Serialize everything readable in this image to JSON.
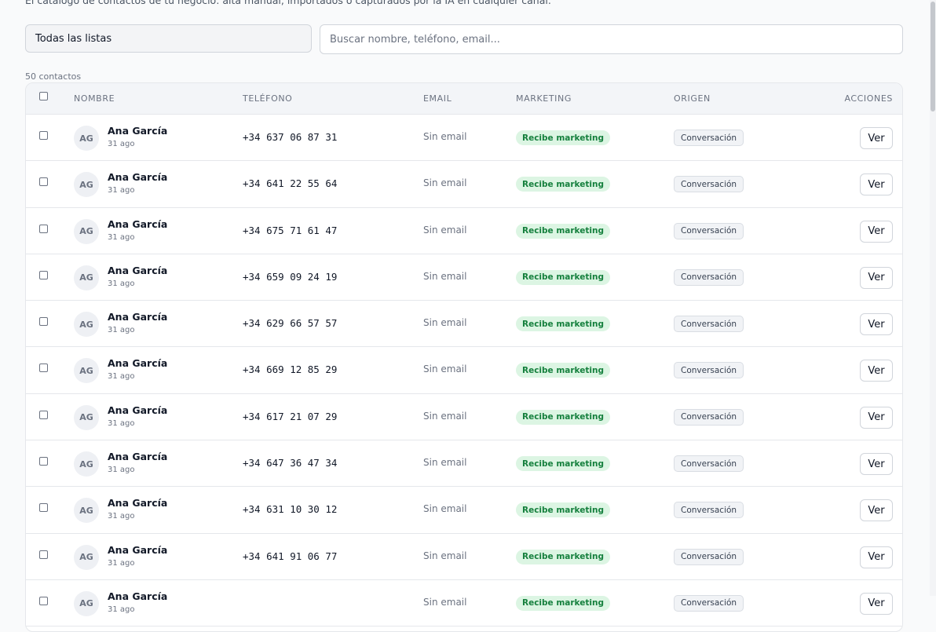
{
  "page": {
    "subtitle": "El catálogo de contactos de tu negocio: alta manual, importados o capturados por la IA en cualquier canal."
  },
  "filters": {
    "list_select": "Todas las listas",
    "search_placeholder": "Buscar nombre, teléfono, email..."
  },
  "summary": {
    "count_label": "50 contactos"
  },
  "table": {
    "headers": {
      "name": "NOMBRE",
      "phone": "TELÉFONO",
      "email": "EMAIL",
      "marketing": "MARKETING",
      "origin": "ORIGEN",
      "actions": "ACCIONES"
    },
    "rows": [
      {
        "initials": "AG",
        "name": "Ana García",
        "ago": "31 ago",
        "phone": "+34 637 06 87 31",
        "email": "Sin email",
        "marketing": "Recibe marketing",
        "origin": "Conversación",
        "action": "Ver"
      },
      {
        "initials": "AG",
        "name": "Ana García",
        "ago": "31 ago",
        "phone": "+34 641 22 55 64",
        "email": "Sin email",
        "marketing": "Recibe marketing",
        "origin": "Conversación",
        "action": "Ver"
      },
      {
        "initials": "AG",
        "name": "Ana García",
        "ago": "31 ago",
        "phone": "+34 675 71 61 47",
        "email": "Sin email",
        "marketing": "Recibe marketing",
        "origin": "Conversación",
        "action": "Ver"
      },
      {
        "initials": "AG",
        "name": "Ana García",
        "ago": "31 ago",
        "phone": "+34 659 09 24 19",
        "email": "Sin email",
        "marketing": "Recibe marketing",
        "origin": "Conversación",
        "action": "Ver"
      },
      {
        "initials": "AG",
        "name": "Ana García",
        "ago": "31 ago",
        "phone": "+34 629 66 57 57",
        "email": "Sin email",
        "marketing": "Recibe marketing",
        "origin": "Conversación",
        "action": "Ver"
      },
      {
        "initials": "AG",
        "name": "Ana García",
        "ago": "31 ago",
        "phone": "+34 669 12 85 29",
        "email": "Sin email",
        "marketing": "Recibe marketing",
        "origin": "Conversación",
        "action": "Ver"
      },
      {
        "initials": "AG",
        "name": "Ana García",
        "ago": "31 ago",
        "phone": "+34 617 21 07 29",
        "email": "Sin email",
        "marketing": "Recibe marketing",
        "origin": "Conversación",
        "action": "Ver"
      },
      {
        "initials": "AG",
        "name": "Ana García",
        "ago": "31 ago",
        "phone": "+34 647 36 47 34",
        "email": "Sin email",
        "marketing": "Recibe marketing",
        "origin": "Conversación",
        "action": "Ver"
      },
      {
        "initials": "AG",
        "name": "Ana García",
        "ago": "31 ago",
        "phone": "+34 631 10 30 12",
        "email": "Sin email",
        "marketing": "Recibe marketing",
        "origin": "Conversación",
        "action": "Ver"
      },
      {
        "initials": "AG",
        "name": "Ana García",
        "ago": "31 ago",
        "phone": "+34 641 91 06 77",
        "email": "Sin email",
        "marketing": "Recibe marketing",
        "origin": "Conversación",
        "action": "Ver"
      },
      {
        "initials": "AG",
        "name": "Ana García",
        "ago": "31 ago",
        "phone": "",
        "email": "Sin email",
        "marketing": "Recibe marketing",
        "origin": "Conversación",
        "action": "Ver"
      }
    ]
  },
  "colors": {
    "marketing_badge_bg": "#dcf5e3",
    "marketing_badge_text": "#15803d",
    "origin_badge_bg": "#f1f3f6"
  }
}
